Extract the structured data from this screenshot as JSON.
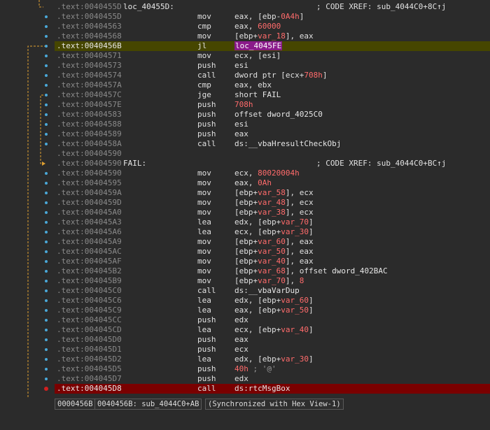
{
  "lines": [
    {
      "addr": ".text:0040455D",
      "label": "loc_40455D:",
      "xref": "; CODE XREF: sub_4044C0+8C↑j"
    },
    {
      "addr": ".text:0040455D",
      "mnem": "mov",
      "ops": [
        [
          "t-reg",
          "eax, ["
        ],
        [
          "t-reg",
          "ebp"
        ],
        [
          "t-reg",
          "-"
        ],
        [
          "t-num",
          "0A4h"
        ],
        [
          "t-reg",
          "]"
        ]
      ]
    },
    {
      "addr": ".text:00404563",
      "mnem": "cmp",
      "ops": [
        [
          "t-reg",
          "eax, "
        ],
        [
          "t-num",
          "60000"
        ]
      ]
    },
    {
      "addr": ".text:00404568",
      "mnem": "mov",
      "ops": [
        [
          "t-reg",
          "["
        ],
        [
          "t-reg",
          "ebp"
        ],
        [
          "t-reg",
          "+"
        ],
        [
          "t-var",
          "var_18"
        ],
        [
          "t-reg",
          "], eax"
        ]
      ]
    },
    {
      "addr": ".text:0040456B",
      "mnem": "jl",
      "ops": [
        [
          "t-jmp-hl",
          "loc_4045FE"
        ]
      ],
      "hl": "sel"
    },
    {
      "addr": ".text:00404571",
      "mnem": "mov",
      "ops": [
        [
          "t-reg",
          "ecx, [esi]"
        ]
      ]
    },
    {
      "addr": ".text:00404573",
      "mnem": "push",
      "ops": [
        [
          "t-reg",
          "esi"
        ]
      ]
    },
    {
      "addr": ".text:00404574",
      "mnem": "call",
      "ops": [
        [
          "t-reg",
          "dword ptr [ecx+"
        ],
        [
          "t-num",
          "708h"
        ],
        [
          "t-reg",
          "]"
        ]
      ]
    },
    {
      "addr": ".text:0040457A",
      "mnem": "cmp",
      "ops": [
        [
          "t-reg",
          "eax, ebx"
        ]
      ]
    },
    {
      "addr": ".text:0040457C",
      "mnem": "jge",
      "ops": [
        [
          "t-reg",
          "short "
        ],
        [
          "t-name",
          "FAIL"
        ]
      ]
    },
    {
      "addr": ".text:0040457E",
      "mnem": "push",
      "ops": [
        [
          "t-num",
          "708h"
        ]
      ]
    },
    {
      "addr": ".text:00404583",
      "mnem": "push",
      "ops": [
        [
          "t-reg",
          "offset "
        ],
        [
          "t-name",
          "dword_4025C0"
        ]
      ]
    },
    {
      "addr": ".text:00404588",
      "mnem": "push",
      "ops": [
        [
          "t-reg",
          "esi"
        ]
      ]
    },
    {
      "addr": ".text:00404589",
      "mnem": "push",
      "ops": [
        [
          "t-reg",
          "eax"
        ]
      ]
    },
    {
      "addr": ".text:0040458A",
      "mnem": "call",
      "ops": [
        [
          "t-reg",
          "ds:"
        ],
        [
          "t-name",
          "__vbaHresultCheckObj"
        ]
      ]
    },
    {
      "addr": ".text:00404590"
    },
    {
      "addr": ".text:00404590",
      "label": "FAIL:",
      "xref": "; CODE XREF: sub_4044C0+BC↑j"
    },
    {
      "addr": ".text:00404590",
      "mnem": "mov",
      "ops": [
        [
          "t-reg",
          "ecx, "
        ],
        [
          "t-num",
          "80020004h"
        ]
      ]
    },
    {
      "addr": ".text:00404595",
      "mnem": "mov",
      "ops": [
        [
          "t-reg",
          "eax, "
        ],
        [
          "t-num",
          "0Ah"
        ]
      ]
    },
    {
      "addr": ".text:0040459A",
      "mnem": "mov",
      "ops": [
        [
          "t-reg",
          "[ebp+"
        ],
        [
          "t-var",
          "var_58"
        ],
        [
          "t-reg",
          "], ecx"
        ]
      ]
    },
    {
      "addr": ".text:0040459D",
      "mnem": "mov",
      "ops": [
        [
          "t-reg",
          "[ebp+"
        ],
        [
          "t-var",
          "var_48"
        ],
        [
          "t-reg",
          "], ecx"
        ]
      ]
    },
    {
      "addr": ".text:004045A0",
      "mnem": "mov",
      "ops": [
        [
          "t-reg",
          "[ebp+"
        ],
        [
          "t-var",
          "var_38"
        ],
        [
          "t-reg",
          "], ecx"
        ]
      ]
    },
    {
      "addr": ".text:004045A3",
      "mnem": "lea",
      "ops": [
        [
          "t-reg",
          "edx, [ebp+"
        ],
        [
          "t-var",
          "var_70"
        ],
        [
          "t-reg",
          "]"
        ]
      ]
    },
    {
      "addr": ".text:004045A6",
      "mnem": "lea",
      "ops": [
        [
          "t-reg",
          "ecx, [ebp+"
        ],
        [
          "t-var",
          "var_30"
        ],
        [
          "t-reg",
          "]"
        ]
      ]
    },
    {
      "addr": ".text:004045A9",
      "mnem": "mov",
      "ops": [
        [
          "t-reg",
          "[ebp+"
        ],
        [
          "t-var",
          "var_60"
        ],
        [
          "t-reg",
          "], eax"
        ]
      ]
    },
    {
      "addr": ".text:004045AC",
      "mnem": "mov",
      "ops": [
        [
          "t-reg",
          "[ebp+"
        ],
        [
          "t-var",
          "var_50"
        ],
        [
          "t-reg",
          "], eax"
        ]
      ]
    },
    {
      "addr": ".text:004045AF",
      "mnem": "mov",
      "ops": [
        [
          "t-reg",
          "[ebp+"
        ],
        [
          "t-var",
          "var_40"
        ],
        [
          "t-reg",
          "], eax"
        ]
      ]
    },
    {
      "addr": ".text:004045B2",
      "mnem": "mov",
      "ops": [
        [
          "t-reg",
          "[ebp+"
        ],
        [
          "t-var",
          "var_68"
        ],
        [
          "t-reg",
          "], offset "
        ],
        [
          "t-name",
          "dword_402BAC"
        ]
      ]
    },
    {
      "addr": ".text:004045B9",
      "mnem": "mov",
      "ops": [
        [
          "t-reg",
          "[ebp+"
        ],
        [
          "t-var",
          "var_70"
        ],
        [
          "t-reg",
          "], "
        ],
        [
          "t-num",
          "8"
        ]
      ]
    },
    {
      "addr": ".text:004045C0",
      "mnem": "call",
      "ops": [
        [
          "t-reg",
          "ds:"
        ],
        [
          "t-name",
          "__vbaVarDup"
        ]
      ]
    },
    {
      "addr": ".text:004045C6",
      "mnem": "lea",
      "ops": [
        [
          "t-reg",
          "edx, [ebp+"
        ],
        [
          "t-var",
          "var_60"
        ],
        [
          "t-reg",
          "]"
        ]
      ]
    },
    {
      "addr": ".text:004045C9",
      "mnem": "lea",
      "ops": [
        [
          "t-reg",
          "eax, [ebp+"
        ],
        [
          "t-var",
          "var_50"
        ],
        [
          "t-reg",
          "]"
        ]
      ]
    },
    {
      "addr": ".text:004045CC",
      "mnem": "push",
      "ops": [
        [
          "t-reg",
          "edx"
        ]
      ]
    },
    {
      "addr": ".text:004045CD",
      "mnem": "lea",
      "ops": [
        [
          "t-reg",
          "ecx, [ebp+"
        ],
        [
          "t-var",
          "var_40"
        ],
        [
          "t-reg",
          "]"
        ]
      ]
    },
    {
      "addr": ".text:004045D0",
      "mnem": "push",
      "ops": [
        [
          "t-reg",
          "eax"
        ]
      ]
    },
    {
      "addr": ".text:004045D1",
      "mnem": "push",
      "ops": [
        [
          "t-reg",
          "ecx"
        ]
      ]
    },
    {
      "addr": ".text:004045D2",
      "mnem": "lea",
      "ops": [
        [
          "t-reg",
          "edx, [ebp+"
        ],
        [
          "t-var",
          "var_30"
        ],
        [
          "t-reg",
          "]"
        ]
      ]
    },
    {
      "addr": ".text:004045D5",
      "mnem": "push",
      "ops": [
        [
          "t-num",
          "40h"
        ],
        [
          "cm",
          " ; '@'"
        ]
      ]
    },
    {
      "addr": ".text:004045D7",
      "mnem": "push",
      "ops": [
        [
          "t-reg",
          "edx"
        ]
      ]
    },
    {
      "addr": ".text:004045D8",
      "mnem": "call",
      "ops": [
        [
          "t-reg",
          "ds:"
        ],
        [
          "t-name",
          "rtcMsgBox"
        ]
      ],
      "hl": "bp"
    }
  ],
  "status": {
    "offset": "0000456B",
    "location": "0040456B: sub_4044C0+AB",
    "sync": "(Synchronized with Hex View-1)"
  },
  "colors": {
    "background": "#2b2b2b",
    "selected_line": "#464600",
    "breakpoint_line": "#7a0000",
    "jump_target_highlight": "#8a1a8a",
    "immediate_and_var": "#ff6b6b",
    "arrow_orange": "#e0a030",
    "breakpoint_dot": "#d02020",
    "gutter_dot": "#4aa8d8"
  }
}
